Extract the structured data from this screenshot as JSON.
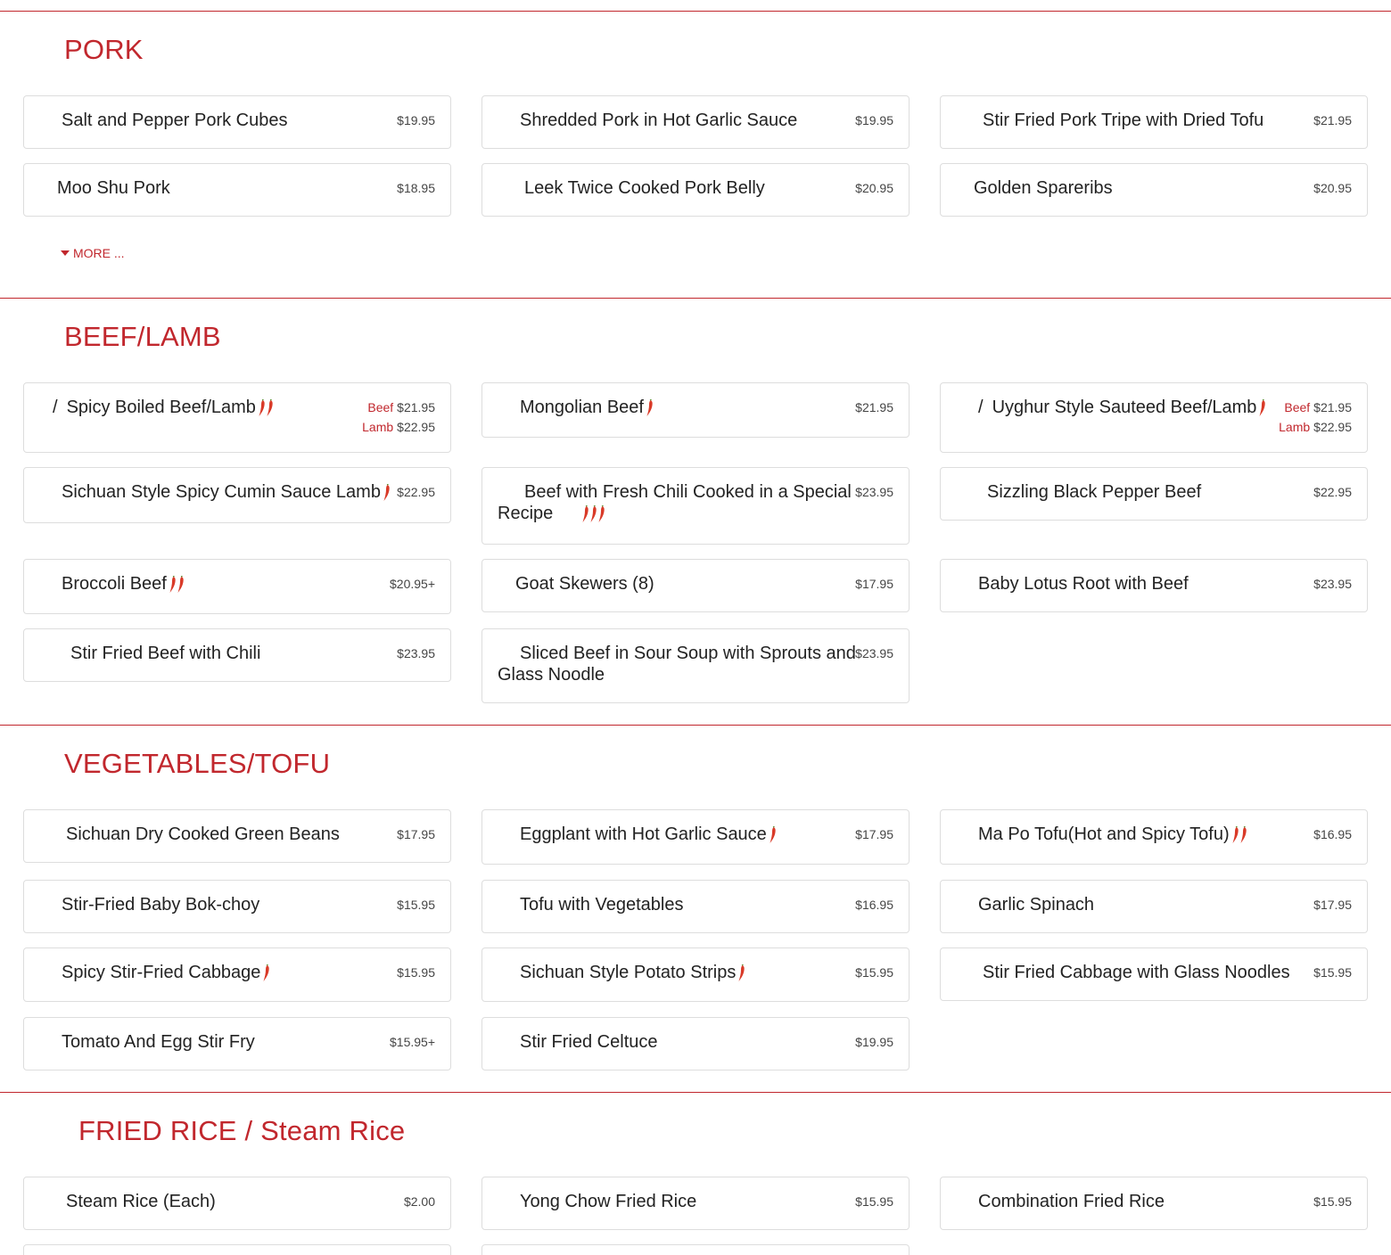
{
  "accent_color": "#c1272d",
  "sections": {
    "pork": {
      "title": "PORK",
      "more_label": "MORE ...",
      "items": [
        {
          "name": "Salt and Pepper Pork Cubes",
          "price": "$19.95",
          "spice": 0
        },
        {
          "name": "Shredded Pork in Hot Garlic Sauce",
          "price": "$19.95",
          "spice": 0
        },
        {
          "name": "Stir Fried Pork Tripe with Dried Tofu",
          "price": "$21.95",
          "spice": 0
        },
        {
          "name": "Moo Shu Pork",
          "price": "$18.95",
          "spice": 0
        },
        {
          "name": "Leek Twice Cooked Pork Belly",
          "price": "$20.95",
          "spice": 0
        },
        {
          "name": "Golden Spareribs",
          "price": "$20.95",
          "spice": 0
        }
      ]
    },
    "beef_lamb": {
      "title": "BEEF/LAMB",
      "items": [
        {
          "name": "Spicy Boiled Beef/Lamb",
          "prefix": "/",
          "spice": 2,
          "options": [
            {
              "label": "Beef",
              "price": "$21.95"
            },
            {
              "label": "Lamb",
              "price": "$22.95"
            }
          ]
        },
        {
          "name": "Mongolian Beef",
          "price": "$21.95",
          "spice": 1
        },
        {
          "name": "Uyghur Style Sauteed Beef/Lamb",
          "prefix": "/",
          "spice": 1,
          "options": [
            {
              "label": "Beef",
              "price": "$21.95"
            },
            {
              "label": "Lamb",
              "price": "$22.95"
            }
          ]
        },
        {
          "name": "Sichuan Style Spicy Cumin Sauce Lamb",
          "price": "$22.95",
          "spice": 1
        },
        {
          "name": "Beef with Fresh Chili Cooked in a Special Recipe",
          "price": "$23.95",
          "spice": 3
        },
        {
          "name": "Sizzling Black Pepper Beef",
          "price": "$22.95",
          "spice": 0
        },
        {
          "name": "Broccoli Beef",
          "price": "$20.95+",
          "spice": 2
        },
        {
          "name": "Goat Skewers (8)",
          "price": "$17.95",
          "spice": 0
        },
        {
          "name": "Baby Lotus Root with Beef",
          "price": "$23.95",
          "spice": 0
        },
        {
          "name": "Stir Fried Beef with Chili",
          "price": "$23.95",
          "spice": 0
        },
        {
          "name": "Sliced Beef in Sour Soup with Sprouts and Glass Noodle",
          "price": "$23.95",
          "spice": 0
        }
      ]
    },
    "vegetables_tofu": {
      "title": "VEGETABLES/TOFU",
      "items": [
        {
          "name": "Sichuan Dry Cooked Green Beans",
          "price": "$17.95",
          "spice": 0
        },
        {
          "name": "Eggplant with Hot Garlic Sauce",
          "price": "$17.95",
          "spice": 1
        },
        {
          "name": "Ma Po Tofu(Hot and Spicy Tofu)",
          "price": "$16.95",
          "spice": 2
        },
        {
          "name": "Stir-Fried Baby Bok-choy",
          "price": "$15.95",
          "spice": 0
        },
        {
          "name": "Tofu with Vegetables",
          "price": "$16.95",
          "spice": 0
        },
        {
          "name": "Garlic Spinach",
          "price": "$17.95",
          "spice": 0
        },
        {
          "name": "Spicy Stir-Fried Cabbage",
          "price": "$15.95",
          "spice": 1
        },
        {
          "name": "Sichuan Style Potato Strips",
          "price": "$15.95",
          "spice": 1
        },
        {
          "name": "Stir Fried Cabbage with Glass Noodles",
          "price": "$15.95",
          "spice": 0
        },
        {
          "name": "Tomato And Egg Stir Fry",
          "price": "$15.95+",
          "spice": 0
        },
        {
          "name": "Stir Fried Celtuce",
          "price": "$19.95",
          "spice": 0
        }
      ]
    },
    "fried_rice": {
      "title": "FRIED RICE / Steam Rice",
      "items": [
        {
          "name": "Steam Rice (Each)",
          "price": "$2.00",
          "spice": 0
        },
        {
          "name": "Yong Chow Fried Rice",
          "price": "$15.95",
          "spice": 0
        },
        {
          "name": "Combination Fried Rice",
          "price": "$15.95",
          "spice": 0
        }
      ]
    }
  }
}
